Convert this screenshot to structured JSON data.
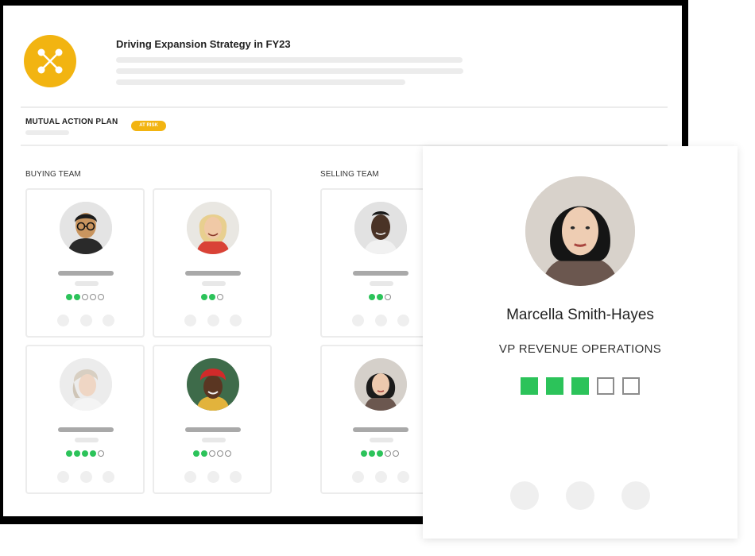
{
  "header": {
    "title": "Driving Expansion Strategy in FY23",
    "logo_icon": "network-nodes-icon",
    "brand_color": "#f2b411"
  },
  "plan": {
    "label": "MUTUAL ACTION PLAN",
    "status_badge": "AT RISK"
  },
  "buying_team": {
    "label": "BUYING TEAM",
    "members": [
      {
        "avatar": "person-avatar-glasses-icon",
        "rating": 2,
        "max": 5
      },
      {
        "avatar": "person-avatar-blonde-icon",
        "rating": 2,
        "max": 3
      },
      {
        "avatar": "person-avatar-profile-icon",
        "rating": 4,
        "max": 5
      },
      {
        "avatar": "person-avatar-headwrap-icon",
        "rating": 2,
        "max": 5
      }
    ]
  },
  "selling_team": {
    "label": "SELLING TEAM",
    "members": [
      {
        "avatar": "person-avatar-man-icon",
        "rating": 2,
        "max": 3
      },
      {
        "avatar": "person-avatar-woman-icon",
        "rating": 3,
        "max": 5
      }
    ]
  },
  "detail": {
    "name": "Marcella Smith-Hayes",
    "title": "VP REVENUE OPERATIONS",
    "rating": 3,
    "max": 5,
    "avatar": "person-avatar-woman-icon"
  },
  "colors": {
    "rating_on": "#2cc35a",
    "rating_off": "#8c8c8c"
  }
}
